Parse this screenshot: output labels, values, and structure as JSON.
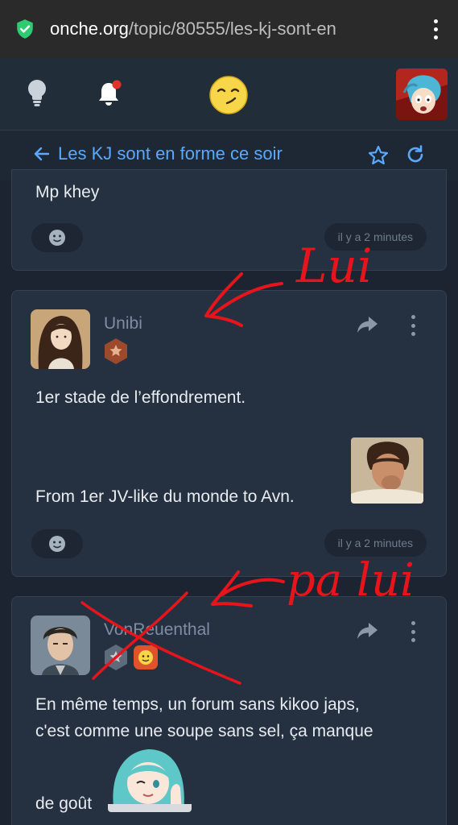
{
  "browser": {
    "url_domain": "onche.org",
    "url_path": "/topic/80555/les-kj-sont-en"
  },
  "header": {
    "icons": [
      "lightbulb-icon",
      "bell-icon",
      "smiley-logo",
      "user-avatar"
    ],
    "notification_dot_color": "#e0342b"
  },
  "topic": {
    "title": "Les KJ sont en forme ce soir",
    "accent_color": "#5aa9ff"
  },
  "posts": [
    {
      "text": "Mp khey",
      "timestamp": "il y a 2 minutes"
    },
    {
      "author": "Unibi",
      "text_1": "1er stade de l’effondrement.",
      "text_2": "From 1er JV-like du monde to Avn.",
      "timestamp": "il y a 2 minutes"
    },
    {
      "author": "VonReuenthal",
      "text_1": "En même temps, un forum sans kikoo japs,",
      "text_2": "c'est comme une soupe sans sel, ça manque",
      "text_3": "de goût"
    }
  ],
  "annotations": {
    "lui": "Lui",
    "pa_lui": "pa lui",
    "color": "#e8141c"
  }
}
